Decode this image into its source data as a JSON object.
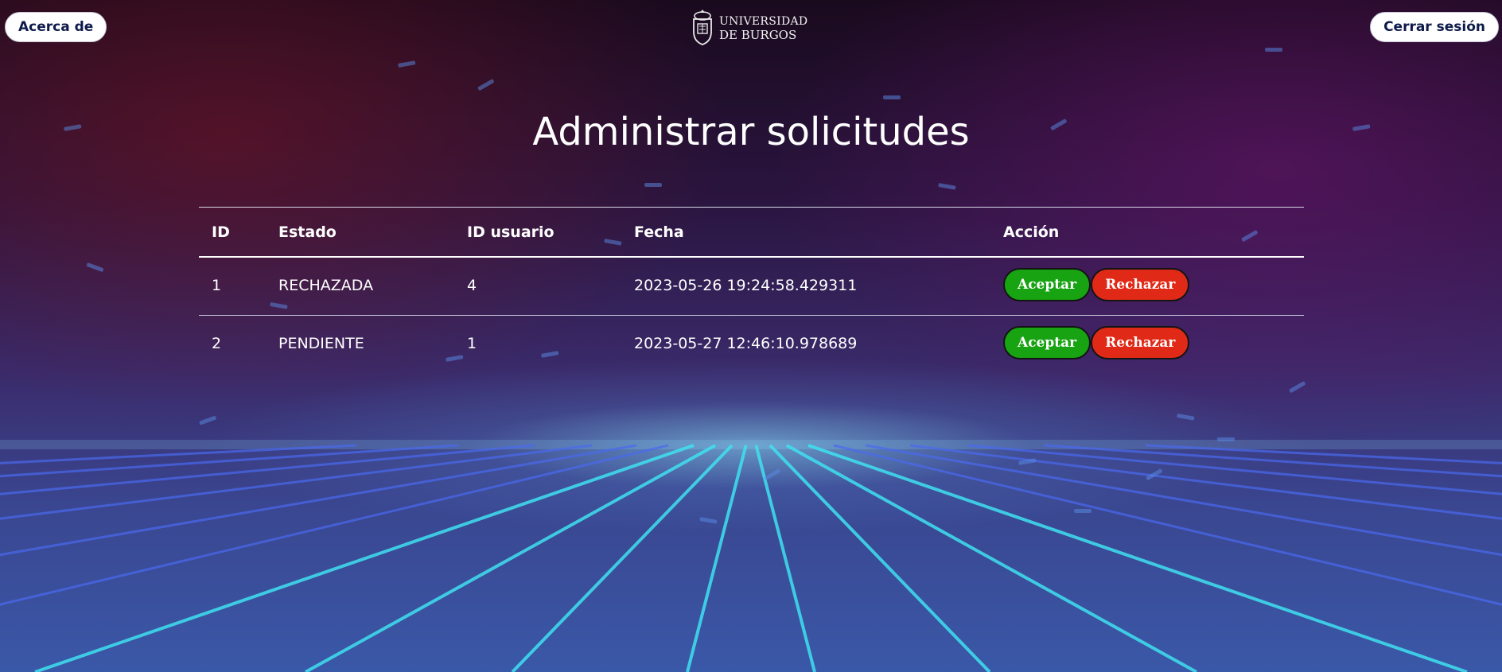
{
  "header": {
    "about_label": "Acerca de",
    "logout_label": "Cerrar sesión",
    "logo_line1": "UNIVERSIDAD",
    "logo_line2": "DE BURGOS"
  },
  "page": {
    "title": "Administrar solicitudes"
  },
  "table": {
    "columns": [
      "ID",
      "Estado",
      "ID usuario",
      "Fecha",
      "Acción"
    ],
    "rows": [
      {
        "id": "1",
        "estado": "RECHAZADA",
        "id_usuario": "4",
        "fecha": "2023-05-26 19:24:58.429311",
        "accept_label": "Aceptar",
        "reject_label": "Rechazar"
      },
      {
        "id": "2",
        "estado": "PENDIENTE",
        "id_usuario": "1",
        "fecha": "2023-05-27 12:46:10.978689",
        "accept_label": "Aceptar",
        "reject_label": "Rechazar"
      }
    ]
  },
  "colors": {
    "accept": "#17a312",
    "reject": "#e02a17",
    "nav_text": "#0d1a4a"
  },
  "icons": {
    "logo": "university-crest-icon"
  }
}
